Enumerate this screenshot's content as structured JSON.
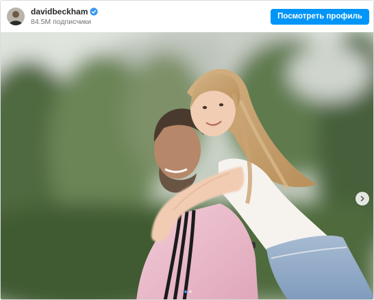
{
  "header": {
    "username": "davidbeckham",
    "followers": "84.5M подписчики",
    "view_profile_label": "Посмотреть профиль",
    "verified_icon": "verified-badge-icon",
    "avatar_icon": "profile-avatar"
  },
  "media": {
    "image_icon": "photo-of-man-and-girl-embracing",
    "next_icon": "chevron-right-icon",
    "carousel": {
      "total": 2,
      "active_index": 0
    }
  },
  "colors": {
    "accent": "#0095f6",
    "verified": "#3897f0",
    "text": "#262626",
    "muted": "#737373"
  }
}
